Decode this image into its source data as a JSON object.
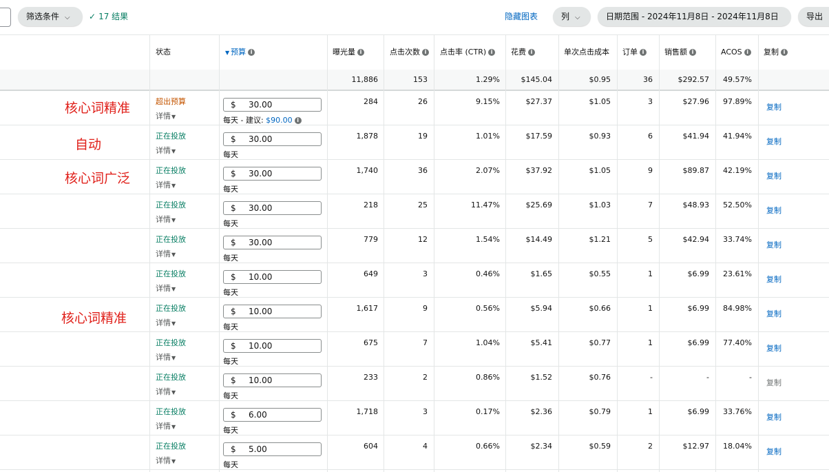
{
  "toolbar": {
    "filter_label": "筛选条件",
    "result_text": "17 结果",
    "hide_chart": "隐藏图表",
    "columns_label": "列",
    "date_range": "日期范围 - 2024年11月8日 - 2024年11月8日",
    "export_label": "导出"
  },
  "headers": {
    "status": "状态",
    "budget": "预算",
    "impressions": "曝光量",
    "clicks": "点击次数",
    "ctr": "点击率 (CTR)",
    "spend": "花费",
    "cpc": "单次点击成本",
    "orders": "订单",
    "sales": "销售额",
    "acos": "ACOS",
    "copy": "复制"
  },
  "summary": {
    "impressions": "11,886",
    "clicks": "153",
    "ctr": "1.29%",
    "spend": "$145.04",
    "cpc": "$0.95",
    "orders": "36",
    "sales": "$292.57",
    "acos": "49.57%"
  },
  "common": {
    "detail": "详情",
    "per_day": "每天",
    "currency": "$",
    "suggest_prefix": " - 建议: ",
    "copy": "复制"
  },
  "annotations": [
    "核心词精准",
    "自动",
    "核心词广泛",
    "核心词精准"
  ],
  "rows": [
    {
      "status": "超出预算",
      "budget": "30.00",
      "suggest": "$90.00",
      "impressions": "284",
      "clicks": "26",
      "ctr": "9.15%",
      "spend": "$27.37",
      "cpc": "$1.05",
      "orders": "3",
      "sales": "$27.96",
      "acos": "97.89%"
    },
    {
      "status": "正在投放",
      "budget": "30.00",
      "impressions": "1,878",
      "clicks": "19",
      "ctr": "1.01%",
      "spend": "$17.59",
      "cpc": "$0.93",
      "orders": "6",
      "sales": "$41.94",
      "acos": "41.94%"
    },
    {
      "status": "正在投放",
      "budget": "30.00",
      "impressions": "1,740",
      "clicks": "36",
      "ctr": "2.07%",
      "spend": "$37.92",
      "cpc": "$1.05",
      "orders": "9",
      "sales": "$89.87",
      "acos": "42.19%"
    },
    {
      "status": "正在投放",
      "budget": "30.00",
      "impressions": "218",
      "clicks": "25",
      "ctr": "11.47%",
      "spend": "$25.69",
      "cpc": "$1.03",
      "orders": "7",
      "sales": "$48.93",
      "acos": "52.50%"
    },
    {
      "status": "正在投放",
      "budget": "30.00",
      "impressions": "779",
      "clicks": "12",
      "ctr": "1.54%",
      "spend": "$14.49",
      "cpc": "$1.21",
      "orders": "5",
      "sales": "$42.94",
      "acos": "33.74%"
    },
    {
      "status": "正在投放",
      "budget": "10.00",
      "impressions": "649",
      "clicks": "3",
      "ctr": "0.46%",
      "spend": "$1.65",
      "cpc": "$0.55",
      "orders": "1",
      "sales": "$6.99",
      "acos": "23.61%"
    },
    {
      "status": "正在投放",
      "budget": "10.00",
      "impressions": "1,617",
      "clicks": "9",
      "ctr": "0.56%",
      "spend": "$5.94",
      "cpc": "$0.66",
      "orders": "1",
      "sales": "$6.99",
      "acos": "84.98%"
    },
    {
      "status": "正在投放",
      "budget": "10.00",
      "impressions": "675",
      "clicks": "7",
      "ctr": "1.04%",
      "spend": "$5.41",
      "cpc": "$0.77",
      "orders": "1",
      "sales": "$6.99",
      "acos": "77.40%"
    },
    {
      "status": "正在投放",
      "budget": "10.00",
      "impressions": "233",
      "clicks": "2",
      "ctr": "0.86%",
      "spend": "$1.52",
      "cpc": "$0.76",
      "orders": "-",
      "sales": "-",
      "acos": "-",
      "copy_disabled": true
    },
    {
      "status": "正在投放",
      "budget": "6.00",
      "impressions": "1,718",
      "clicks": "3",
      "ctr": "0.17%",
      "spend": "$2.36",
      "cpc": "$0.79",
      "orders": "1",
      "sales": "$6.99",
      "acos": "33.76%"
    },
    {
      "status": "正在投放",
      "budget": "5.00",
      "impressions": "604",
      "clicks": "4",
      "ctr": "0.66%",
      "spend": "$2.34",
      "cpc": "$0.59",
      "orders": "2",
      "sales": "$12.97",
      "acos": "18.04%"
    }
  ]
}
